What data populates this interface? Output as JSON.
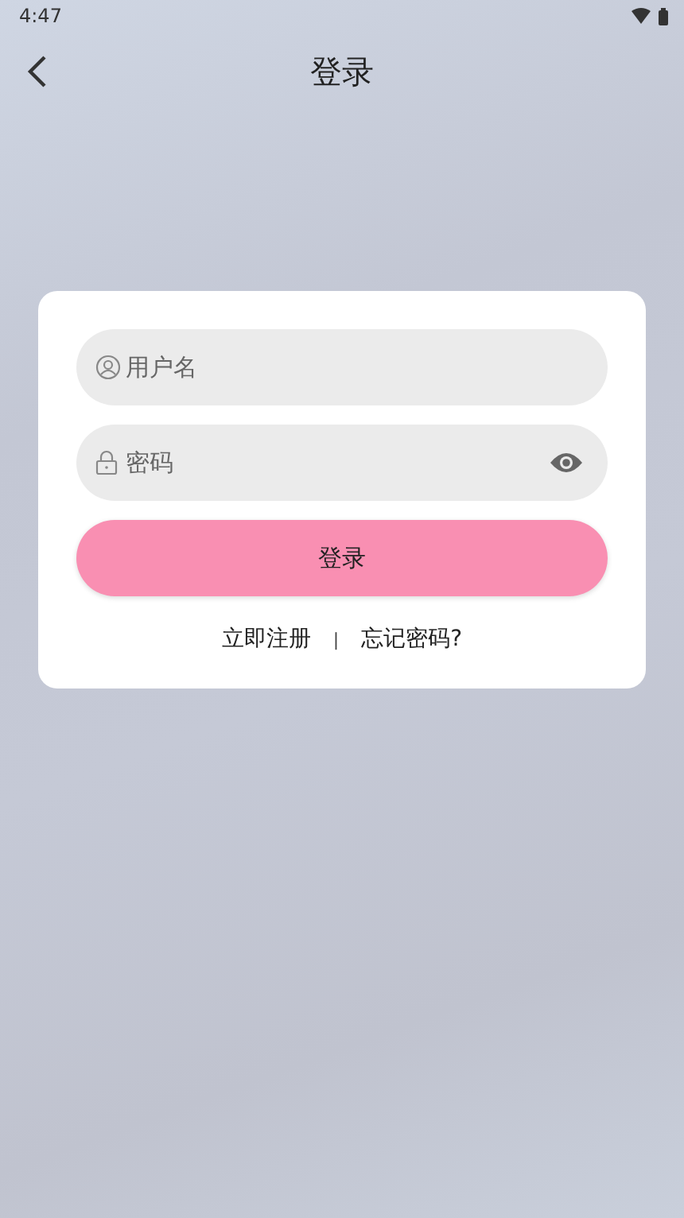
{
  "status_bar": {
    "time": "4:47"
  },
  "header": {
    "title": "登录"
  },
  "form": {
    "username": {
      "placeholder": "用户名"
    },
    "password": {
      "placeholder": "密码"
    },
    "submit": "登录",
    "links": [
      {
        "kind": "link",
        "text": "立即注册"
      },
      {
        "kind": "separator",
        "text": "|"
      },
      {
        "kind": "link",
        "text": "忘记密码?"
      }
    ]
  }
}
